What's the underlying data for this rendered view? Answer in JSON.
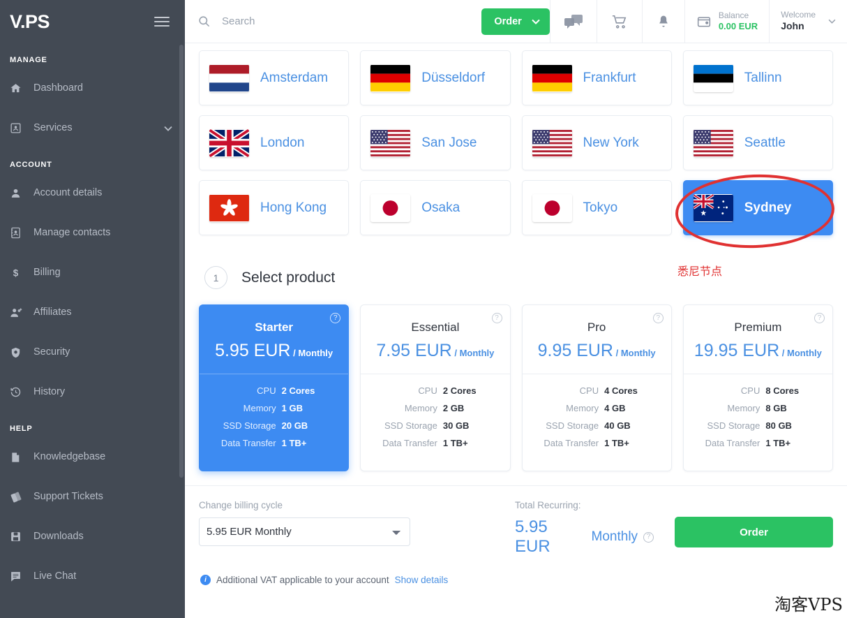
{
  "brand": {
    "logo": "V.PS"
  },
  "sidebar": {
    "sections": [
      {
        "title": "MANAGE",
        "items": [
          {
            "label": "Dashboard",
            "icon": "home-icon",
            "chevron": false
          },
          {
            "label": "Services",
            "icon": "services-icon",
            "chevron": true
          }
        ]
      },
      {
        "title": "ACCOUNT",
        "items": [
          {
            "label": "Account details",
            "icon": "user-icon",
            "chevron": false
          },
          {
            "label": "Manage contacts",
            "icon": "contacts-icon",
            "chevron": false
          },
          {
            "label": "Billing",
            "icon": "dollar-icon",
            "chevron": false
          },
          {
            "label": "Affiliates",
            "icon": "affiliates-icon",
            "chevron": false
          },
          {
            "label": "Security",
            "icon": "shield-icon",
            "chevron": false
          },
          {
            "label": "History",
            "icon": "history-icon",
            "chevron": false
          }
        ]
      },
      {
        "title": "HELP",
        "items": [
          {
            "label": "Knowledgebase",
            "icon": "document-icon",
            "chevron": false
          },
          {
            "label": "Support Tickets",
            "icon": "tickets-icon",
            "chevron": false
          },
          {
            "label": "Downloads",
            "icon": "save-icon",
            "chevron": false
          },
          {
            "label": "Live Chat",
            "icon": "chat-icon",
            "chevron": false
          }
        ]
      }
    ]
  },
  "header": {
    "search_placeholder": "Search",
    "search_value": "",
    "order_label": "Order",
    "messages_count": "0",
    "balance_label": "Balance",
    "balance_value": "0.00 EUR",
    "welcome_label": "Welcome",
    "welcome_name": "John"
  },
  "locations": [
    {
      "name": "Amsterdam",
      "flag": "nl",
      "selected": false
    },
    {
      "name": "Düsseldorf",
      "flag": "de",
      "selected": false
    },
    {
      "name": "Frankfurt",
      "flag": "de",
      "selected": false
    },
    {
      "name": "Tallinn",
      "flag": "ee",
      "selected": false
    },
    {
      "name": "London",
      "flag": "gb",
      "selected": false
    },
    {
      "name": "San Jose",
      "flag": "us",
      "selected": false
    },
    {
      "name": "New York",
      "flag": "us",
      "selected": false
    },
    {
      "name": "Seattle",
      "flag": "us",
      "selected": false
    },
    {
      "name": "Hong Kong",
      "flag": "hk",
      "selected": false
    },
    {
      "name": "Osaka",
      "flag": "jp",
      "selected": false
    },
    {
      "name": "Tokyo",
      "flag": "jp",
      "selected": false
    },
    {
      "name": "Sydney",
      "flag": "au",
      "selected": true
    }
  ],
  "annotation": {
    "text": "悉尼节点",
    "color": "#e03131"
  },
  "step": {
    "number": "1",
    "title": "Select product"
  },
  "products": [
    {
      "name": "Starter",
      "price": "5.95 EUR",
      "cycle": "/ Monthly",
      "selected": true,
      "specs": [
        {
          "key": "CPU",
          "value": "2 Cores"
        },
        {
          "key": "Memory",
          "value": "1 GB"
        },
        {
          "key": "SSD Storage",
          "value": "20 GB"
        },
        {
          "key": "Data Transfer",
          "value": "1 TB+"
        }
      ]
    },
    {
      "name": "Essential",
      "price": "7.95 EUR",
      "cycle": "/ Monthly",
      "selected": false,
      "specs": [
        {
          "key": "CPU",
          "value": "2 Cores"
        },
        {
          "key": "Memory",
          "value": "2 GB"
        },
        {
          "key": "SSD Storage",
          "value": "30 GB"
        },
        {
          "key": "Data Transfer",
          "value": "1 TB+"
        }
      ]
    },
    {
      "name": "Pro",
      "price": "9.95 EUR",
      "cycle": "/ Monthly",
      "selected": false,
      "specs": [
        {
          "key": "CPU",
          "value": "4 Cores"
        },
        {
          "key": "Memory",
          "value": "4 GB"
        },
        {
          "key": "SSD Storage",
          "value": "40 GB"
        },
        {
          "key": "Data Transfer",
          "value": "1 TB+"
        }
      ]
    },
    {
      "name": "Premium",
      "price": "19.95 EUR",
      "cycle": "/ Monthly",
      "selected": false,
      "specs": [
        {
          "key": "CPU",
          "value": "8 Cores"
        },
        {
          "key": "Memory",
          "value": "8 GB"
        },
        {
          "key": "SSD Storage",
          "value": "80 GB"
        },
        {
          "key": "Data Transfer",
          "value": "1 TB+"
        }
      ]
    }
  ],
  "footer": {
    "billing_label": "Change billing cycle",
    "billing_selected": "5.95 EUR Monthly",
    "billing_options": [
      "5.95 EUR Monthly"
    ],
    "total_label": "Total Recurring:",
    "total_amount": "5.95 EUR",
    "total_cycle": "Monthly",
    "order_label": "Order",
    "vat_text": "Additional VAT applicable to your account",
    "vat_link": "Show details"
  },
  "watermark": "淘客VPS",
  "colors": {
    "accent_blue": "#3d8bf2",
    "link_blue": "#4a90e2",
    "green": "#2bc263",
    "sidebar": "#434a54",
    "annotation_red": "#e03131"
  }
}
